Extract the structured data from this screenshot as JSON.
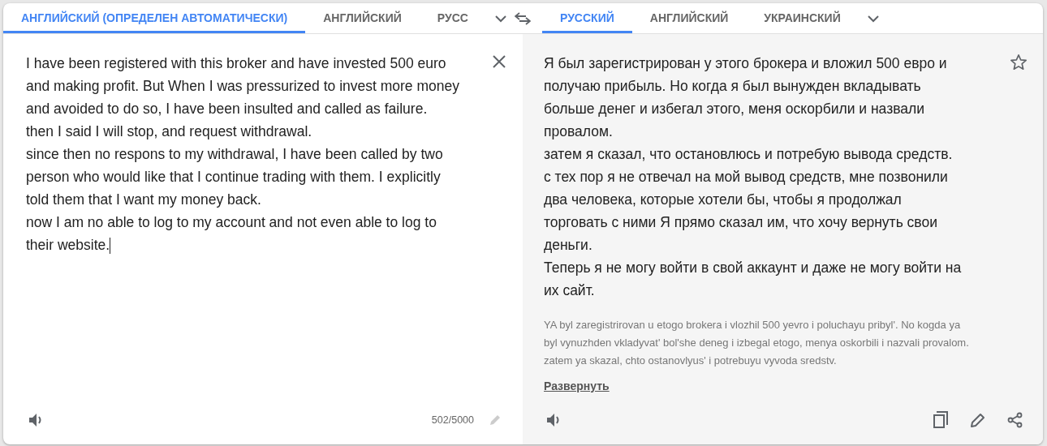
{
  "source": {
    "tabs": [
      {
        "label": "АНГЛИЙСКИЙ (ОПРЕДЕЛЕН АВТОМАТИЧЕСКИ)",
        "selected": true
      },
      {
        "label": "АНГЛИЙСКИЙ",
        "selected": false
      },
      {
        "label": "РУСС",
        "selected": false
      }
    ],
    "lines": [
      "I have been registered with this broker and have invested 500 euro",
      "and making profit. But When I was pressurized to invest more money",
      "and avoided to do so, I have been insulted and called as failure.",
      "then I said I will stop, and request withdrawal.",
      "since then no respons to my withdrawal, I have been called by two",
      "person who would like that I continue trading with them. I explicitly",
      "told them that I want my money back.",
      "now I am no able to log to my account and not even able to log to",
      "their website."
    ],
    "char_count": "502/5000"
  },
  "target": {
    "tabs": [
      {
        "label": "РУССКИЙ",
        "selected": true
      },
      {
        "label": "АНГЛИЙСКИЙ",
        "selected": false
      },
      {
        "label": "УКРАИНСКИЙ",
        "selected": false
      }
    ],
    "lines": [
      "Я был зарегистрирован у этого брокера и вложил 500 евро и",
      "получаю прибыль. Но когда я был вынужден вкладывать",
      "больше денег и избегал этого, меня оскорбили и назвали",
      "провалом.",
      "затем я сказал, что остановлюсь и потребую вывода средств.",
      "с тех пор я не отвечал на мой вывод средств, мне позвонили",
      "два человека, которые хотели бы, чтобы я продолжал",
      "торговать с ними Я прямо сказал им, что хочу вернуть свои",
      "деньги.",
      "Теперь я не могу войти в свой аккаунт и даже не могу войти на",
      "их сайт."
    ],
    "transliteration": [
      "YA byl zaregistrirovan u etogo brokera i vlozhil 500 yevro i poluchayu pribyl'. No kogda ya",
      "byl vynuzhden vkladyvat' bol'she deneg i izbegal etogo, menya oskorbili i nazvali provalom.",
      "zatem ya skazal, chto ostanovlyus' i potrebuyu vyvoda sredstv."
    ],
    "expand_link": "Развернуть"
  }
}
